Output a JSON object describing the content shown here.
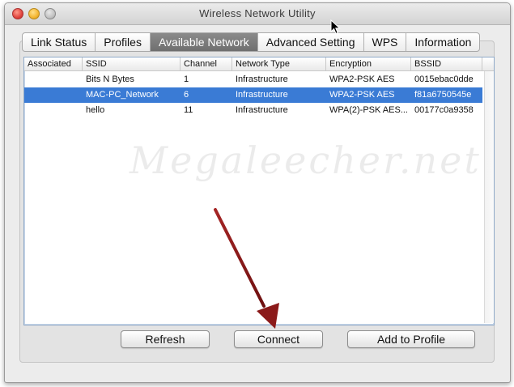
{
  "window": {
    "title": "Wireless Network Utility"
  },
  "tabs": [
    {
      "label": "Link Status"
    },
    {
      "label": "Profiles"
    },
    {
      "label": "Available Network",
      "active": true
    },
    {
      "label": "Advanced Setting"
    },
    {
      "label": "WPS"
    },
    {
      "label": "Information"
    }
  ],
  "table": {
    "headers": [
      "Associated",
      "SSID",
      "Channel",
      "Network Type",
      "Encryption",
      "BSSID"
    ],
    "rows": [
      {
        "associated": "",
        "ssid": "Bits N Bytes",
        "channel": "1",
        "network_type": "Infrastructure",
        "encryption": "WPA2-PSK AES",
        "bssid": "0015ebac0dde"
      },
      {
        "associated": "",
        "ssid": "MAC-PC_Network",
        "channel": "6",
        "network_type": "Infrastructure",
        "encryption": "WPA2-PSK AES",
        "bssid": "f81a6750545e",
        "selected": true
      },
      {
        "associated": "",
        "ssid": "hello",
        "channel": "11",
        "network_type": "Infrastructure",
        "encryption": "WPA(2)-PSK AES...",
        "bssid": "00177c0a9358"
      }
    ]
  },
  "watermark": "Megaleecher.net",
  "buttons": {
    "refresh": "Refresh",
    "connect": "Connect",
    "add_to_profile": "Add to Profile"
  },
  "colors": {
    "selection": "#3a7bd5",
    "annotation_arrow": "#8b1a1a"
  },
  "icons": {
    "close": "close-icon",
    "minimize": "minimize-icon",
    "zoom": "zoom-icon",
    "cursor": "mouse-pointer-icon",
    "annotation": "red-arrow-icon"
  }
}
